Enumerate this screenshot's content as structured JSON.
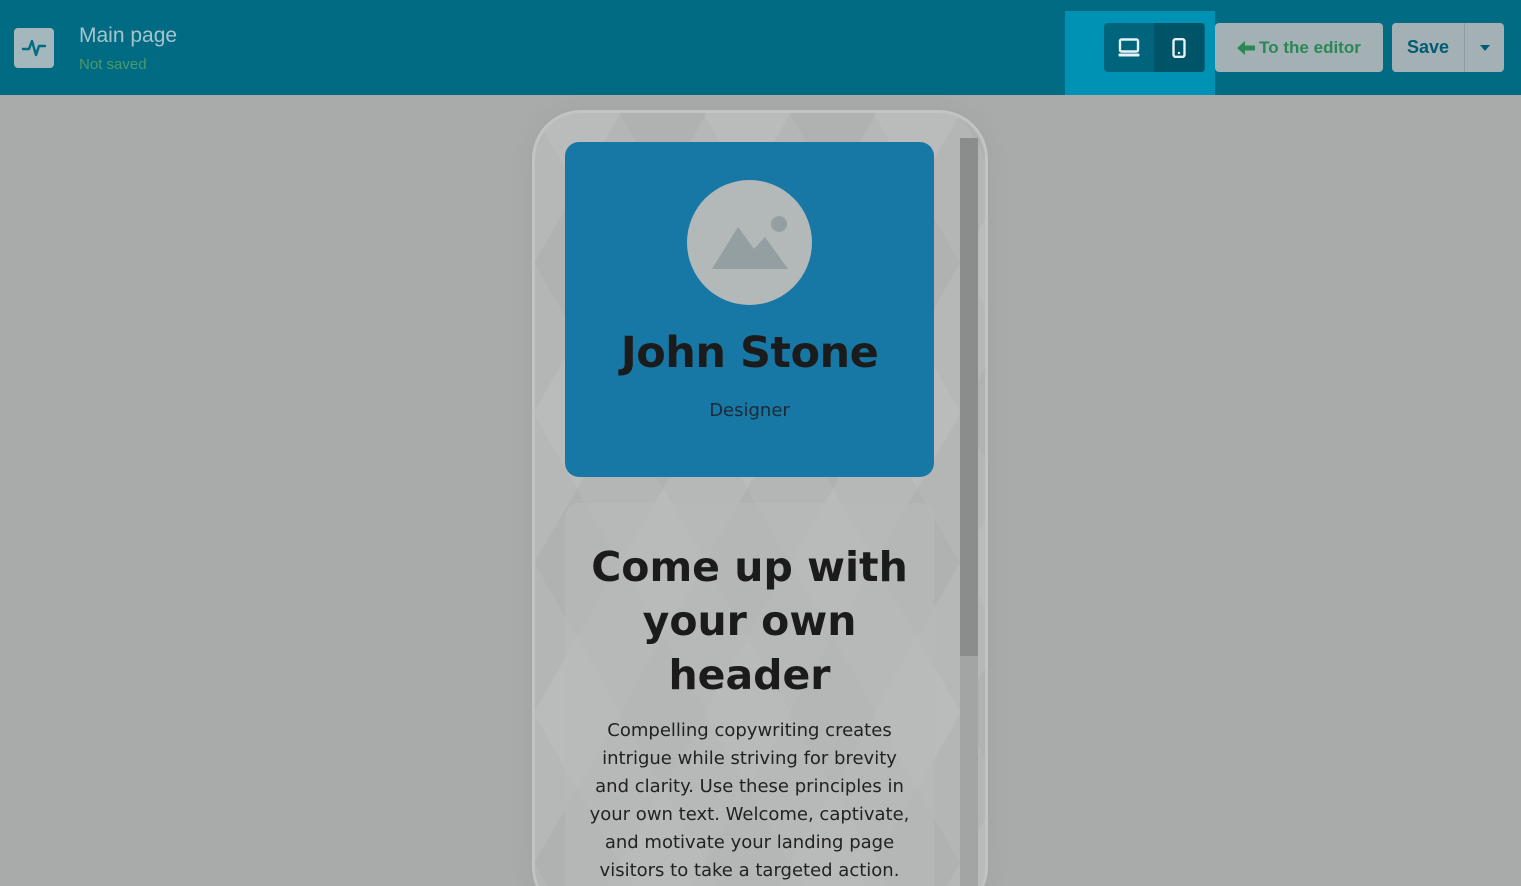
{
  "header": {
    "title": "Main page",
    "status": "Not saved",
    "editor_button_label": "To the editor",
    "save_button_label": "Save",
    "icons": {
      "app": "pulse-icon",
      "desktop": "monitor-icon",
      "mobile": "smartphone-icon",
      "back": "arrow-left-icon",
      "dropdown": "caret-down-icon"
    },
    "active_device": "mobile"
  },
  "preview": {
    "profile": {
      "name": "John Stone",
      "role": "Designer",
      "avatar_icon": "image-placeholder-icon"
    },
    "content": {
      "heading": "Come up with your own header",
      "body": "Compelling copywriting creates intrigue while striving for brevity and clarity. Use these principles in your own text. Welcome, captivate, and motivate your landing page visitors to take a targeted action."
    }
  },
  "colors": {
    "topbar": "#006b82",
    "device_panel": "#0092b4",
    "profile_card": "#1778a6",
    "status_green": "#4a9a6a"
  }
}
